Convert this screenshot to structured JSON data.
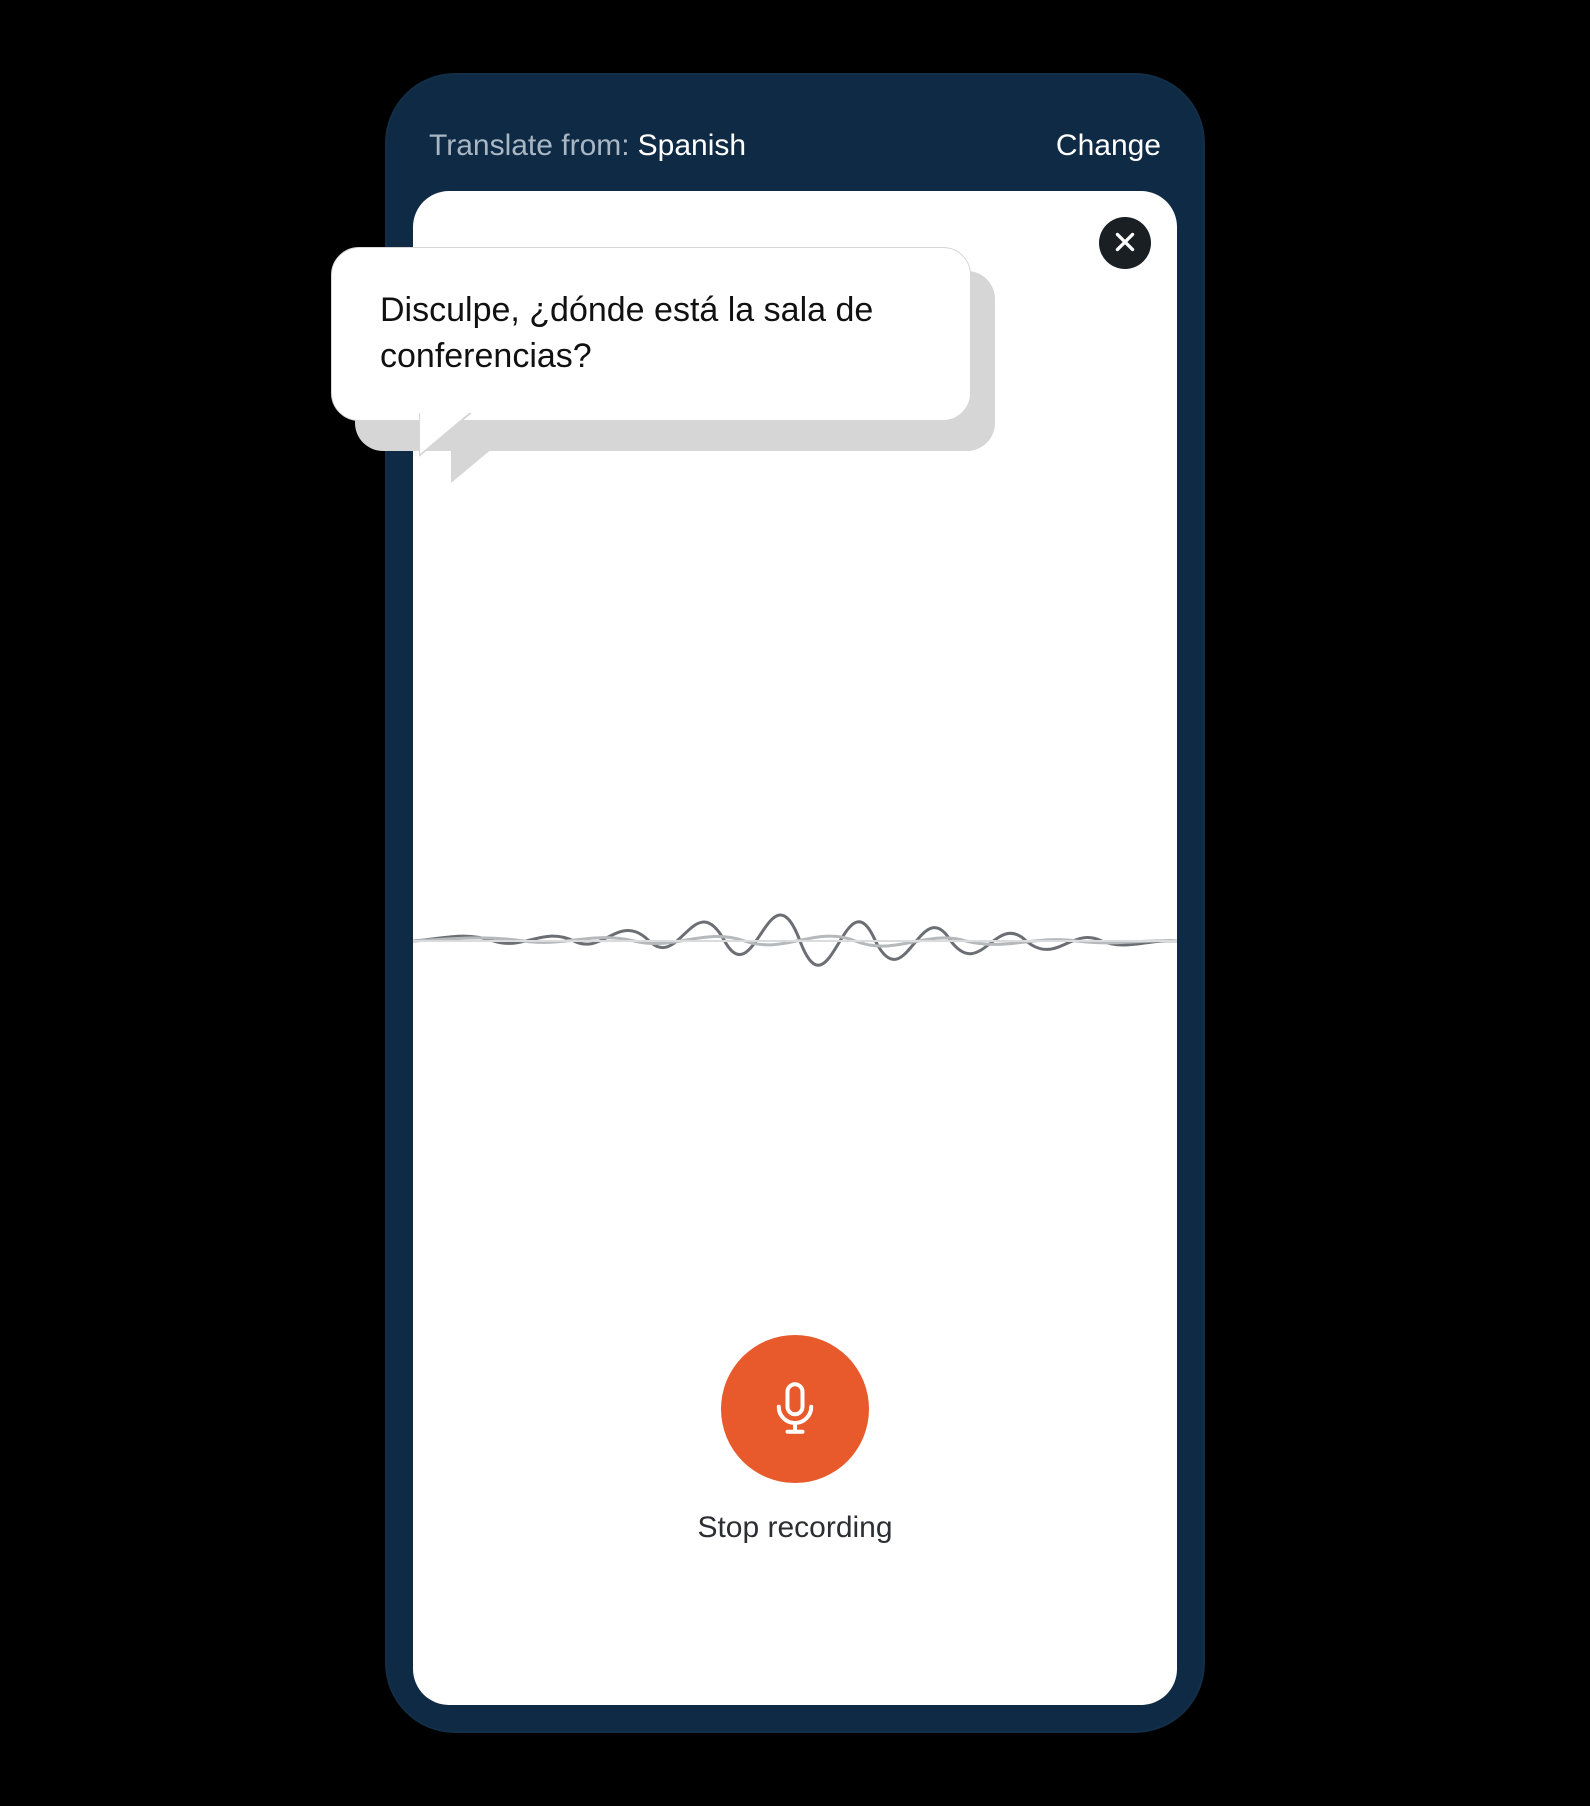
{
  "header": {
    "prefix": "Translate from:",
    "language": "Spanish",
    "change_label": "Change"
  },
  "bubble": {
    "text": "Disculpe, ¿dónde está la sala de conferencias?"
  },
  "mic": {
    "label": "Stop recording"
  },
  "colors": {
    "phone_frame": "#0f2a44",
    "accent": "#e85a2c",
    "close_bg": "#1a1f24"
  }
}
